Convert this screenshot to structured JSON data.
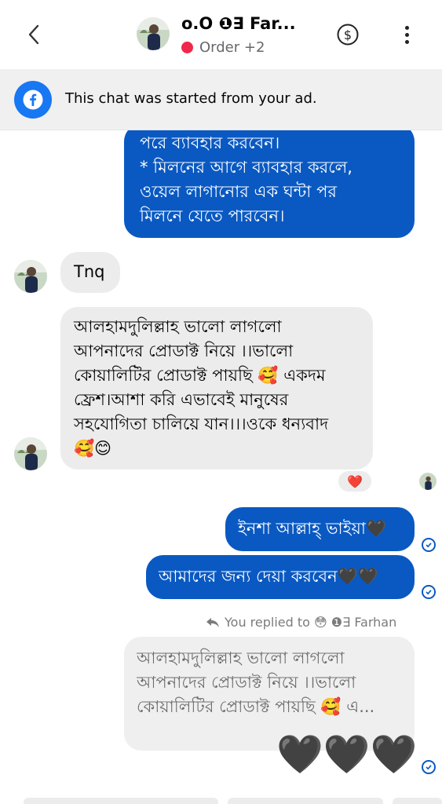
{
  "header": {
    "title": "o.O ❶∃ Far...",
    "subtitle": "Order +2",
    "status_color": "#f0284a"
  },
  "ad_banner": {
    "text": "This chat was started from your ad."
  },
  "messages": {
    "first_out_lines": [
      "পরে ব্যাবহার করবেন।",
      "* মিলনের আগে ব্যাবহার করলে,",
      "ওয়েল লাগানোর এক ঘন্টা পর",
      "মিলনে যেতে পারবেন।"
    ],
    "tnq": "Tnq",
    "long_in_lines": [
      "আলহামদুলিল্লাহ ভালো লাগলো",
      "আপনাদের প্রোডাক্ট নিয়ে ।।ভালো",
      "কোয়ালিটির প্রোডাক্ট পায়ছি 🥰 একদম",
      "ফ্রেশ।আশা করি এভাবেই মানুষের",
      "সহযোগিতা চালিয়ে যান।।।ওকে ধন্যবাদ",
      "🥰😊"
    ],
    "reaction": "❤️",
    "insha": "ইনশা আল্লাহ্ ভাইয়া🖤",
    "amader": "আমাদের জন্য দেয়া করবেন🖤🖤",
    "reply_label": "You replied to 😳 ❶∃ Farhan",
    "quoted_lines": [
      "আলহামদুলিল্লাহ ভালো লাগলো",
      "আপনাদের প্রোডাক্ট নিয়ে ।।ভালো",
      "কোয়ালিটির প্রোডাক্ট পায়ছি 🥰 এ..."
    ],
    "hearts": "🖤🖤🖤"
  },
  "colors": {
    "outgoing_bubble": "#0a59c2",
    "incoming_bubble": "#ececec",
    "facebook_blue": "#1877f2"
  }
}
